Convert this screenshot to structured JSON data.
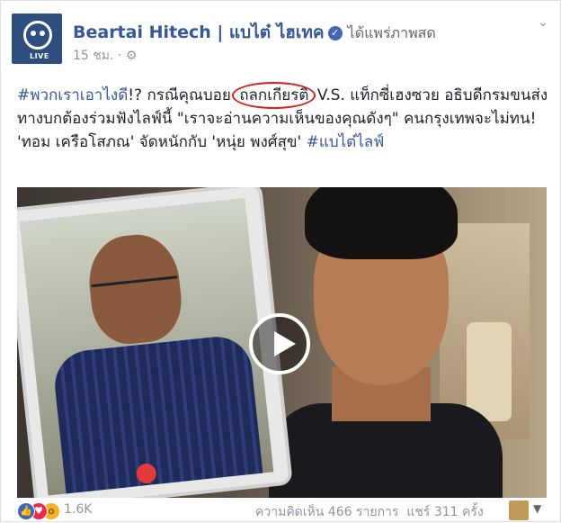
{
  "post": {
    "page_name": "Beartai Hitech | แบไต๋ ไฮเทค",
    "action": "ได้แพร่ภาพสด",
    "time": "15 ชม.",
    "separator": "·",
    "avatar_label": "LIVE",
    "hashtag1": "#พวกเราเอาไงดี",
    "text_part1": "!? กรณีคุณบอย ",
    "circled_word": "ถลกเกียรติ",
    "text_part2": " V.S. แท็กซี่เฮงซวย อธิบดีกรมขนส่งทางบกต้องร่วมฟังไลฟ์นี้ \"เราจะอ่านความเห็นของคุณดังๆ\" คนกรุงเทพจะไม่ทน! 'ทอม เครือโสภณ' จัดหนักกับ 'หนุ่ย พงศ์สุข' ",
    "hashtag2": "#แบไต๋ไลฟ์"
  },
  "footer": {
    "reaction_count": "1.6K",
    "comments": "ความคิดเห็น 466 รายการ",
    "shares": "แชร์ 311 ครั้ง"
  },
  "icons": {
    "verified": "verified-check-icon",
    "globe": "globe-icon",
    "play": "play-icon",
    "like": "like-reaction-icon",
    "love": "love-reaction-icon",
    "wow": "wow-reaction-icon"
  },
  "colors": {
    "link": "#365899",
    "circle": "#d72020",
    "like": "#4267b2",
    "love": "#f0284a",
    "wow": "#f7b125"
  }
}
